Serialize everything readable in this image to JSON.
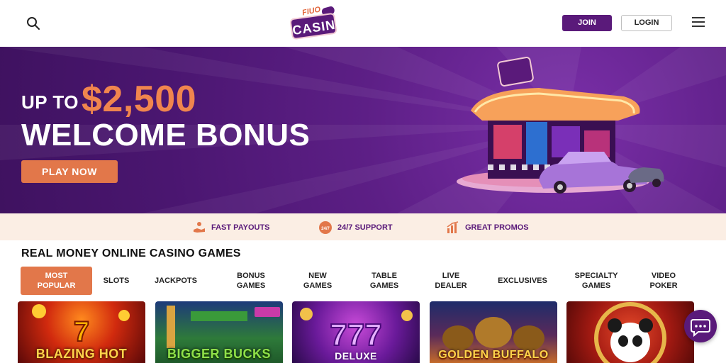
{
  "header": {
    "logo_small": "FIUO",
    "logo_main": "CASINO",
    "join_label": "JOIN",
    "login_label": "LOGIN",
    "icons": {
      "search": "search-icon",
      "menu": "hamburger-menu-icon"
    }
  },
  "hero": {
    "up_to": "UP TO",
    "amount": "$2,500",
    "headline": "WELCOME BONUS",
    "cta_label": "PLAY NOW",
    "colors": {
      "background": "#5d1f86",
      "accent": "#f0854e",
      "cta": "#e2774a"
    }
  },
  "features": [
    {
      "label": "FAST PAYOUTS",
      "icon": "hand-coins-icon"
    },
    {
      "label": "24/7 SUPPORT",
      "icon": "support-24-7-icon",
      "badge": "24/7"
    },
    {
      "label": "GREAT PROMOS",
      "icon": "bar-chart-icon"
    }
  ],
  "games": {
    "title": "REAL MONEY ONLINE CASINO GAMES",
    "tabs": [
      {
        "label": "MOST\nPOPULAR",
        "active": true
      },
      {
        "label": "SLOTS"
      },
      {
        "label": "JACKPOTS"
      },
      {
        "label": "BONUS\nGAMES"
      },
      {
        "label": "NEW\nGAMES"
      },
      {
        "label": "TABLE\nGAMES"
      },
      {
        "label": "LIVE\nDEALER"
      },
      {
        "label": "EXCLUSIVES"
      },
      {
        "label": "SPECIALTY\nGAMES"
      },
      {
        "label": "VIDEO\nPOKER"
      }
    ],
    "cards": [
      {
        "title": "BLAZING HOT"
      },
      {
        "title": "BIGGER BUCKS"
      },
      {
        "title": "DELUXE"
      },
      {
        "title": "GOLDEN BUFFALO"
      },
      {
        "title": ""
      }
    ]
  },
  "chat": {
    "icon": "chat-bubble-icon"
  }
}
